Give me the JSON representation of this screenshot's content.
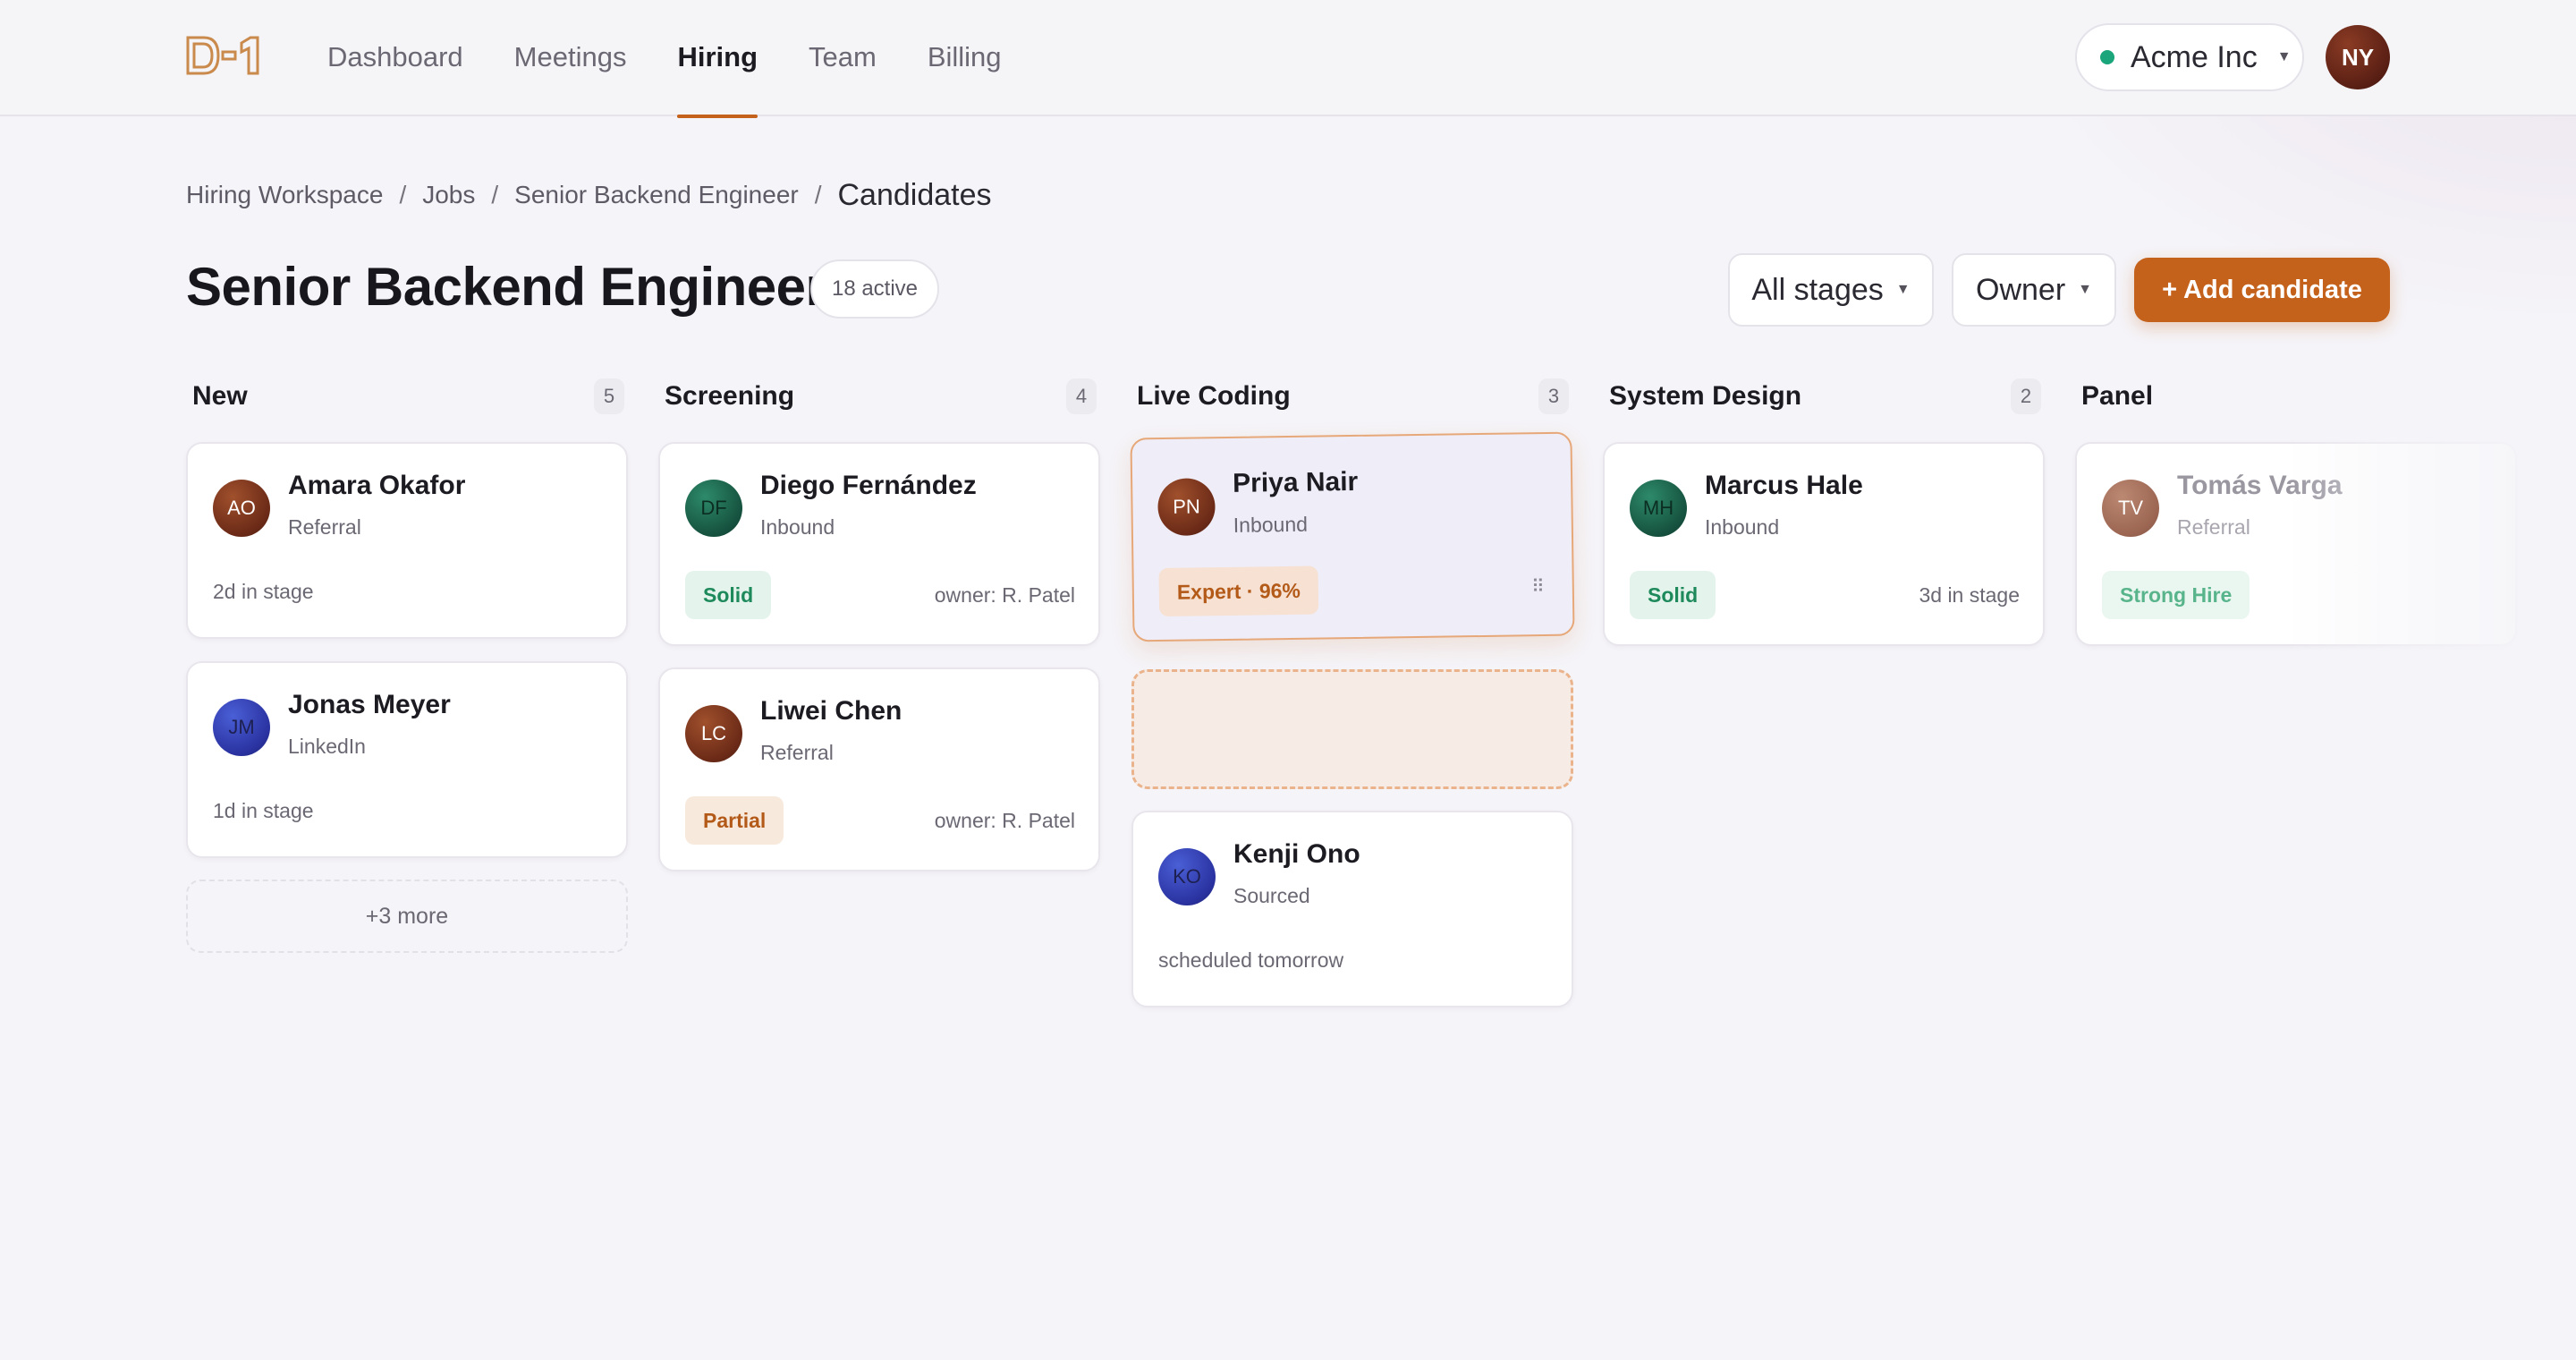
{
  "topbar": {
    "logo_text": "D-1",
    "nav": [
      {
        "label": "Dashboard",
        "active": false
      },
      {
        "label": "Meetings",
        "active": false
      },
      {
        "label": "Hiring",
        "active": true
      },
      {
        "label": "Team",
        "active": false
      },
      {
        "label": "Billing",
        "active": false
      }
    ],
    "org_name": "Acme Inc",
    "org_status_color": "#1aa57a",
    "user_initials": "NY"
  },
  "breadcrumb": {
    "items": [
      "Hiring Workspace",
      "Jobs",
      "Senior Backend Engineer"
    ],
    "separator": "/",
    "current": "Candidates"
  },
  "header": {
    "title": "Senior Backend Engineer",
    "active_count": "18 active",
    "stage_filter": "All stages",
    "owner_filter": "Owner",
    "add_button": "+ Add candidate"
  },
  "accent_color": "#c4611a",
  "columns": [
    {
      "title": "New",
      "count": "5",
      "cards": [
        {
          "initials": "AO",
          "name": "Amara Okafor",
          "source": "Referral",
          "meta": "2d in stage"
        },
        {
          "initials": "JM",
          "name": "Jonas Meyer",
          "source": "LinkedIn",
          "meta": "1d in stage"
        }
      ],
      "more": "+3 more"
    },
    {
      "title": "Screening",
      "count": "4",
      "cards": [
        {
          "initials": "DF",
          "name": "Diego Fernández",
          "source": "Inbound",
          "tag": "Solid",
          "owner": "owner: R. Patel"
        },
        {
          "initials": "LC",
          "name": "Liwei Chen",
          "source": "Referral",
          "tag": "Partial",
          "owner": "owner: R. Patel"
        }
      ]
    },
    {
      "title": "Live Coding",
      "count": "3",
      "dragged_card": {
        "initials": "PN",
        "name": "Priya Nair",
        "source": "Inbound",
        "tag": "Expert · 96%",
        "handle": "⠿"
      },
      "cards": [
        {
          "initials": "KO",
          "name": "Kenji Ono",
          "source": "Sourced",
          "meta": "scheduled tomorrow"
        }
      ]
    },
    {
      "title": "System Design",
      "count": "2",
      "cards": [
        {
          "initials": "MH",
          "name": "Marcus Hale",
          "source": "Inbound",
          "tag": "Solid",
          "meta": "3d in stage"
        }
      ]
    },
    {
      "title": "Panel",
      "cards": [
        {
          "initials": "TV",
          "name": "Tomás Varga",
          "source": "Referral",
          "tag": "Strong Hire"
        }
      ]
    }
  ]
}
